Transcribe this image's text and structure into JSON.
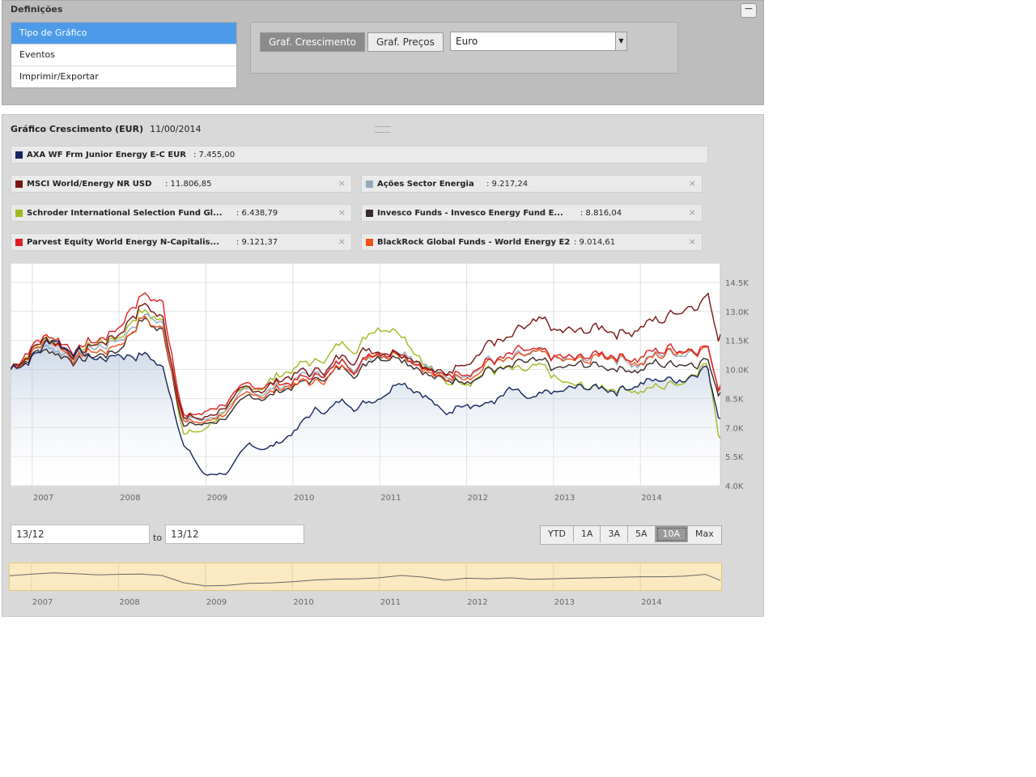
{
  "settings": {
    "title": "Definições",
    "collapse_label": "−",
    "menu": [
      "Tipo de Gráfico",
      "Eventos",
      "Imprimir/Exportar"
    ],
    "chart_type_buttons": [
      "Graf. Crescimento",
      "Graf. Preços"
    ],
    "currency": "Euro"
  },
  "chart_panel": {
    "title": "Gráfico Crescimento (EUR)",
    "date": "11/00/2014",
    "legend": [
      {
        "name": "AXA WF Frm Junior Energy E-C EUR",
        "value": ": 7.455,00",
        "color": "#16255e",
        "removable": false
      },
      {
        "name": "MSCI World/Energy NR USD",
        "value": ": 11.806,85",
        "color": "#7a1515",
        "removable": true
      },
      {
        "name": "Ações Sector Energia",
        "value": ": 9.217,24",
        "color": "#90aabf",
        "removable": true
      },
      {
        "name": "Schroder International Selection Fund Gl...",
        "value": ": 6.438,79",
        "color": "#a3b820",
        "removable": true
      },
      {
        "name": "Invesco Funds - Invesco Energy Fund E...",
        "value": ": 8.816,04",
        "color": "#3b2a2a",
        "removable": true
      },
      {
        "name": "Parvest Equity World Energy N-Capitalis...",
        "value": ": 9.121,37",
        "color": "#e02020",
        "removable": true
      },
      {
        "name": "BlackRock Global Funds - World Energy E2",
        "value": ": 9.014,61",
        "color": "#f0501a",
        "removable": true
      }
    ],
    "remove_glyph": "×",
    "date_from": "13/12",
    "date_to": "13/12",
    "to_label": "to",
    "ranges": [
      "YTD",
      "1A",
      "3A",
      "5A",
      "10A",
      "Max"
    ],
    "selected_range": "10A"
  },
  "chart_data": {
    "type": "line",
    "x": [
      2006.75,
      2007.0,
      2007.25,
      2007.5,
      2007.75,
      2008.0,
      2008.25,
      2008.5,
      2008.75,
      2009.0,
      2009.25,
      2009.5,
      2009.75,
      2010.0,
      2010.25,
      2010.5,
      2010.75,
      2011.0,
      2011.25,
      2011.5,
      2011.75,
      2012.0,
      2012.25,
      2012.5,
      2012.75,
      2013.0,
      2013.25,
      2013.5,
      2013.75,
      2014.0,
      2014.25,
      2014.5,
      2014.75,
      2014.92
    ],
    "series": [
      {
        "name": "AXA WF Frm Junior Energy E-C EUR",
        "color": "#16255e",
        "values": [
          10000,
          10900,
          11600,
          11200,
          10500,
          10800,
          11000,
          10200,
          6200,
          4500,
          4800,
          5900,
          6100,
          6800,
          7700,
          8200,
          8400,
          8900,
          10200,
          9300,
          7600,
          8700,
          8400,
          8900,
          8100,
          8400,
          8700,
          8900,
          9200,
          9500,
          9500,
          9800,
          10800,
          7455
        ]
      },
      {
        "name": "MSCI World/Energy NR USD",
        "color": "#7a1515",
        "values": [
          10000,
          11300,
          11600,
          11000,
          11300,
          11800,
          13500,
          12800,
          7800,
          7600,
          8300,
          8700,
          9200,
          9700,
          9700,
          10400,
          11000,
          11400,
          11600,
          10900,
          9800,
          10900,
          11700,
          11400,
          11800,
          11500,
          11600,
          11900,
          12100,
          12400,
          12600,
          13300,
          14500,
          11807
        ]
      },
      {
        "name": "Ações Sector Energia",
        "color": "#90aabf",
        "values": [
          10000,
          11200,
          11400,
          10900,
          11100,
          11500,
          13100,
          12400,
          7600,
          7400,
          8100,
          8500,
          9000,
          9500,
          9500,
          10200,
          10500,
          11300,
          11600,
          10800,
          9500,
          10200,
          10600,
          10300,
          10400,
          10200,
          10300,
          10600,
          10700,
          10500,
          10800,
          11000,
          11600,
          9217
        ]
      },
      {
        "name": "Schroder International Selection Fund Gl...",
        "color": "#a3b820",
        "values": [
          10000,
          11400,
          11800,
          11200,
          11300,
          11600,
          13300,
          12700,
          6800,
          6900,
          8200,
          8600,
          9400,
          10100,
          10400,
          11000,
          11300,
          12800,
          12600,
          11100,
          9400,
          9900,
          10300,
          9900,
          9700,
          9200,
          8800,
          9000,
          9300,
          9100,
          9200,
          9500,
          11000,
          6439
        ]
      },
      {
        "name": "Invesco Funds - Invesco Energy Fund E...",
        "color": "#3b2a2a",
        "values": [
          10000,
          11000,
          11200,
          10700,
          10800,
          11100,
          12800,
          12100,
          7300,
          7100,
          7800,
          8200,
          8700,
          9300,
          9300,
          9900,
          10300,
          11100,
          11300,
          10500,
          9300,
          9900,
          10300,
          10000,
          10100,
          9700,
          9800,
          10000,
          10200,
          10100,
          10300,
          10500,
          11000,
          8816
        ]
      },
      {
        "name": "Parvest Equity World Energy N-Capitalis...",
        "color": "#e02020",
        "values": [
          10000,
          11400,
          11900,
          11300,
          11600,
          12200,
          14300,
          13400,
          7800,
          7700,
          8400,
          8800,
          9200,
          9600,
          9500,
          10100,
          10500,
          11300,
          11600,
          10800,
          9600,
          10300,
          10700,
          10400,
          10500,
          10300,
          10300,
          10700,
          10900,
          10800,
          11100,
          11400,
          11900,
          9121
        ]
      },
      {
        "name": "BlackRock Global Funds - World Energy E2",
        "color": "#f0501a",
        "values": [
          10000,
          11100,
          11400,
          10800,
          11000,
          11400,
          13000,
          12300,
          7500,
          7300,
          8000,
          8400,
          8900,
          9400,
          9300,
          10000,
          10400,
          11200,
          11500,
          10700,
          9400,
          10100,
          10500,
          10200,
          10300,
          10100,
          10100,
          10500,
          10700,
          10600,
          10900,
          11200,
          11600,
          9015
        ]
      }
    ],
    "ylim": [
      4000,
      15500
    ],
    "y_ticks": [
      4000,
      5500,
      7000,
      8500,
      10000,
      11500,
      13000,
      14500
    ],
    "y_tick_labels": [
      "4.0K",
      "5.5K",
      "7.0K",
      "8.5K",
      "10.0K",
      "11.5K",
      "13.0K",
      "14.5K"
    ],
    "x_tick_labels": [
      "2007",
      "2008",
      "2009",
      "2010",
      "2011",
      "2012",
      "2013",
      "2014"
    ],
    "xlim": [
      2006.75,
      2014.92
    ],
    "grid": true
  }
}
